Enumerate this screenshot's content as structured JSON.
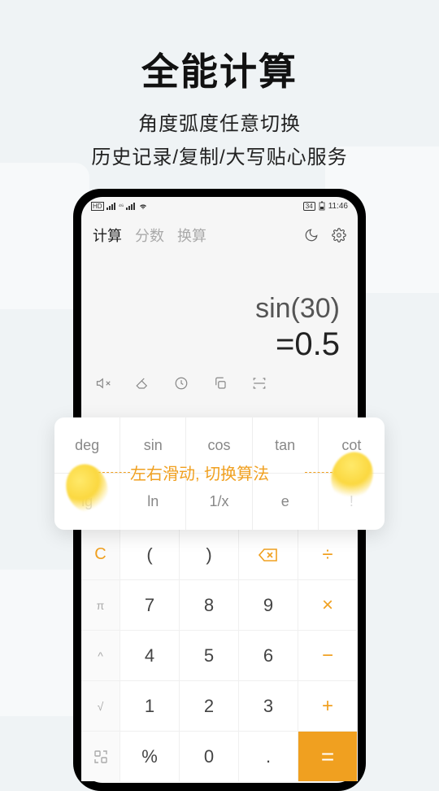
{
  "hero": {
    "title": "全能计算",
    "sub1": "角度弧度任意切换",
    "sub2": "历史记录/复制/大写贴心服务"
  },
  "status": {
    "battery": "34",
    "time": "11:46"
  },
  "tabs": {
    "calculate": "计算",
    "fraction": "分数",
    "convert": "换算"
  },
  "display": {
    "expression": "sin(30)",
    "result": "=0.5"
  },
  "sci": {
    "deg": "deg",
    "sin": "sin",
    "cos": "cos",
    "tan": "tan",
    "cot": "cot",
    "lg": "lg",
    "ln": "ln",
    "inv": "1/x",
    "e": "e",
    "fact": "!"
  },
  "hint": "左右滑动, 切换算法",
  "keys": {
    "c": "C",
    "pi": "π",
    "caret": "^",
    "sqrt": "√",
    "scan": "⌘",
    "pct": "%",
    "lparen": "(",
    "rparen": ")",
    "div": "÷",
    "mul": "×",
    "minus": "−",
    "plus": "+",
    "eq": "=",
    "dot": ".",
    "n0": "0",
    "n1": "1",
    "n2": "2",
    "n3": "3",
    "n4": "4",
    "n5": "5",
    "n6": "6",
    "n7": "7",
    "n8": "8",
    "n9": "9"
  }
}
